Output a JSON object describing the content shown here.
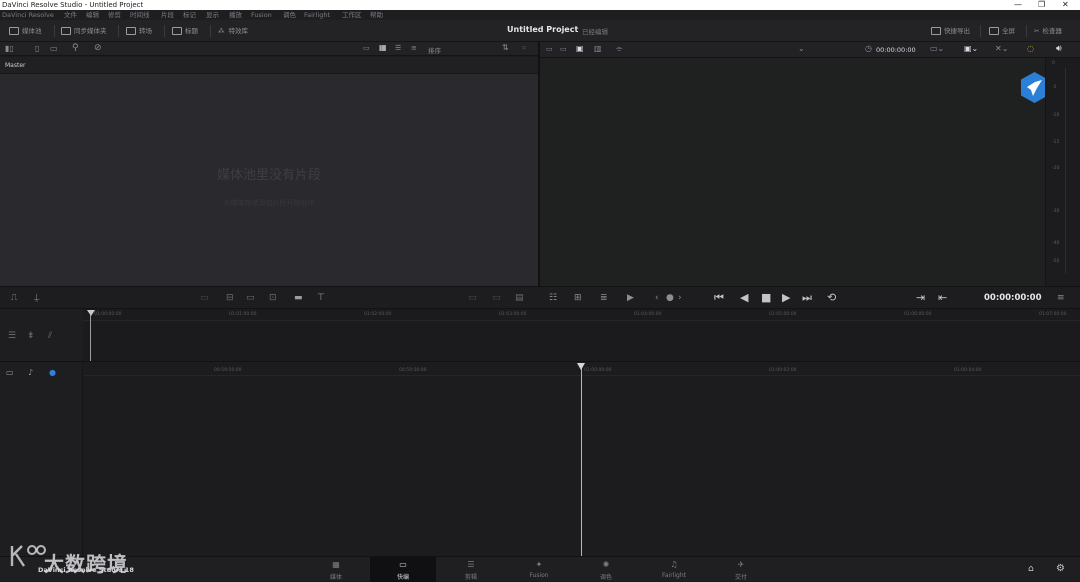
{
  "window": {
    "title": "DaVinci Resolve Studio - Untitled Project",
    "controls": [
      "—",
      "❐",
      "✕"
    ]
  },
  "menu": [
    "DaVinci Resolve",
    "文件",
    "编辑",
    "修剪",
    "时间线",
    "片段",
    "标记",
    "显示",
    "播放",
    "Fusion",
    "调色",
    "Fairlight",
    "工作区",
    "帮助"
  ],
  "toolbar": {
    "media_pool": "媒体池",
    "sync_bin": "同步媒体夹",
    "transitions": "转场",
    "titles": "标题",
    "effects": "特效库",
    "project_title": "Untitled Project",
    "project_status": "已经编辑",
    "quick_export": "快捷导出",
    "full_screen": "全屏",
    "inspector": "检查器"
  },
  "media_pool": {
    "sort_label": "排序",
    "bin_name": "Master",
    "empty_title": "媒体池里没有片段",
    "empty_hint": "从媒体存储添加片段开始创作"
  },
  "viewer": {
    "timecode": "00:00:00:00",
    "meter_ticks": [
      "0",
      "-5",
      "-10",
      "-15",
      "-20",
      "-30",
      "-40",
      "-50"
    ]
  },
  "transport": {
    "timecode": "00:00:00:00"
  },
  "upper_timeline": {
    "ticks": [
      "01:00:00:00",
      "01:01:00:00",
      "01:02:00:00",
      "01:03:00:00",
      "01:04:00:00",
      "01:05:00:00",
      "01:06:00:00",
      "01:07:00:00"
    ]
  },
  "lower_timeline": {
    "ticks": [
      "00:59:56:00",
      "00:59:58:00",
      "01:00:00:00",
      "01:00:02:00",
      "01:00:04:00"
    ]
  },
  "pages": [
    {
      "label": "媒体",
      "icon": "▦"
    },
    {
      "label": "快编",
      "icon": "▭"
    },
    {
      "label": "剪辑",
      "icon": "☰"
    },
    {
      "label": "Fusion",
      "icon": "✦"
    },
    {
      "label": "调色",
      "icon": "✺"
    },
    {
      "label": "Fairlight",
      "icon": "♫"
    },
    {
      "label": "交付",
      "icon": "✈"
    }
  ],
  "brand_label": "DaVinci Resolve Studio 18",
  "watermark": "大数跨境"
}
